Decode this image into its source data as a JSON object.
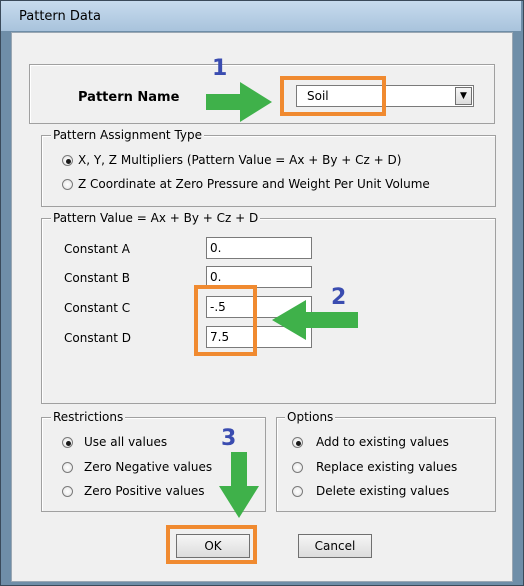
{
  "window": {
    "title": "Pattern Data"
  },
  "pattern_name": {
    "label": "Pattern Name",
    "selected": "Soil",
    "dropdown_arrow": "▼"
  },
  "assignment": {
    "legend": "Pattern Assignment Type",
    "options": [
      {
        "label": "X, Y, Z Multipliers  (Pattern Value = Ax + By + Cz + D)",
        "selected": true
      },
      {
        "label": "Z Coordinate at Zero Pressure and Weight Per Unit Volume",
        "selected": false
      }
    ]
  },
  "pattern_value": {
    "legend": "Pattern Value = Ax + By + Cz + D",
    "constants": [
      {
        "label": "Constant  A",
        "value": "0."
      },
      {
        "label": "Constant  B",
        "value": "0."
      },
      {
        "label": "Constant  C",
        "value": "-.5"
      },
      {
        "label": "Constant  D",
        "value": "7.5"
      }
    ]
  },
  "restrictions": {
    "legend": "Restrictions",
    "options": [
      {
        "label": "Use all values",
        "selected": true
      },
      {
        "label": "Zero Negative values",
        "selected": false
      },
      {
        "label": "Zero Positive values",
        "selected": false
      }
    ]
  },
  "options_group": {
    "legend": "Options",
    "options": [
      {
        "label": "Add to existing values",
        "selected": true
      },
      {
        "label": "Replace existing values",
        "selected": false
      },
      {
        "label": "Delete existing values",
        "selected": false
      }
    ]
  },
  "buttons": {
    "ok": "OK",
    "cancel": "Cancel"
  },
  "annotations": {
    "step1": "1",
    "step2": "2",
    "step3": "3",
    "highlight_color": "#f08a30",
    "arrow_color": "#3fb14a",
    "number_color": "#3a4cb0"
  }
}
